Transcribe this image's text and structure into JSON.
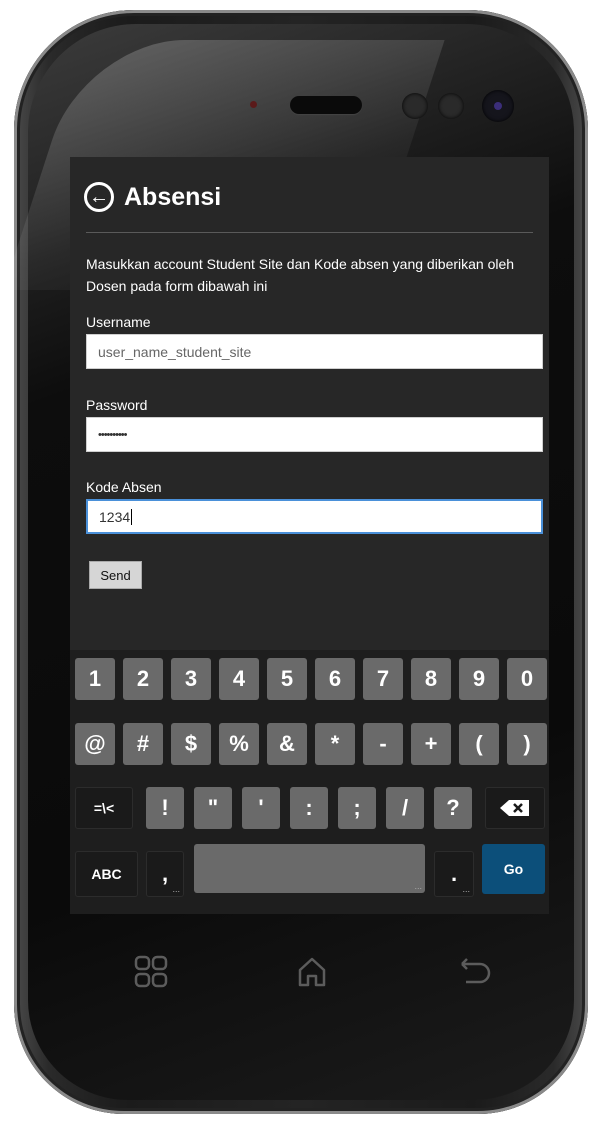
{
  "header": {
    "title": "Absensi",
    "back_icon": "back-arrow-circle-icon"
  },
  "form": {
    "instructions": "Masukkan account Student Site dan Kode absen yang diberikan oleh Dosen pada form dibawah ini",
    "username_label": "Username",
    "username_placeholder": "user_name_student_site",
    "password_label": "Password",
    "password_value": "••••••••••",
    "kode_label": "Kode Absen",
    "kode_value": "1234",
    "send_label": "Send"
  },
  "keyboard": {
    "row1": [
      "1",
      "2",
      "3",
      "4",
      "5",
      "6",
      "7",
      "8",
      "9",
      "0"
    ],
    "row2": [
      "@",
      "#",
      "$",
      "%",
      "&",
      "*",
      "-",
      "+",
      "(",
      ")"
    ],
    "row3": [
      "=\\<",
      "!",
      "\"",
      "'",
      ":",
      ";",
      "/",
      "?"
    ],
    "row4": {
      "abc": "ABC",
      "comma": ",",
      "period": ".",
      "go": "Go"
    }
  },
  "colors": {
    "screen_bg": "#272727",
    "go_key": "#0c4f7a",
    "focus": "#4a90d9"
  },
  "nav": {
    "recent_icon": "recent-apps-icon",
    "home_icon": "home-icon",
    "back_icon": "back-icon"
  }
}
